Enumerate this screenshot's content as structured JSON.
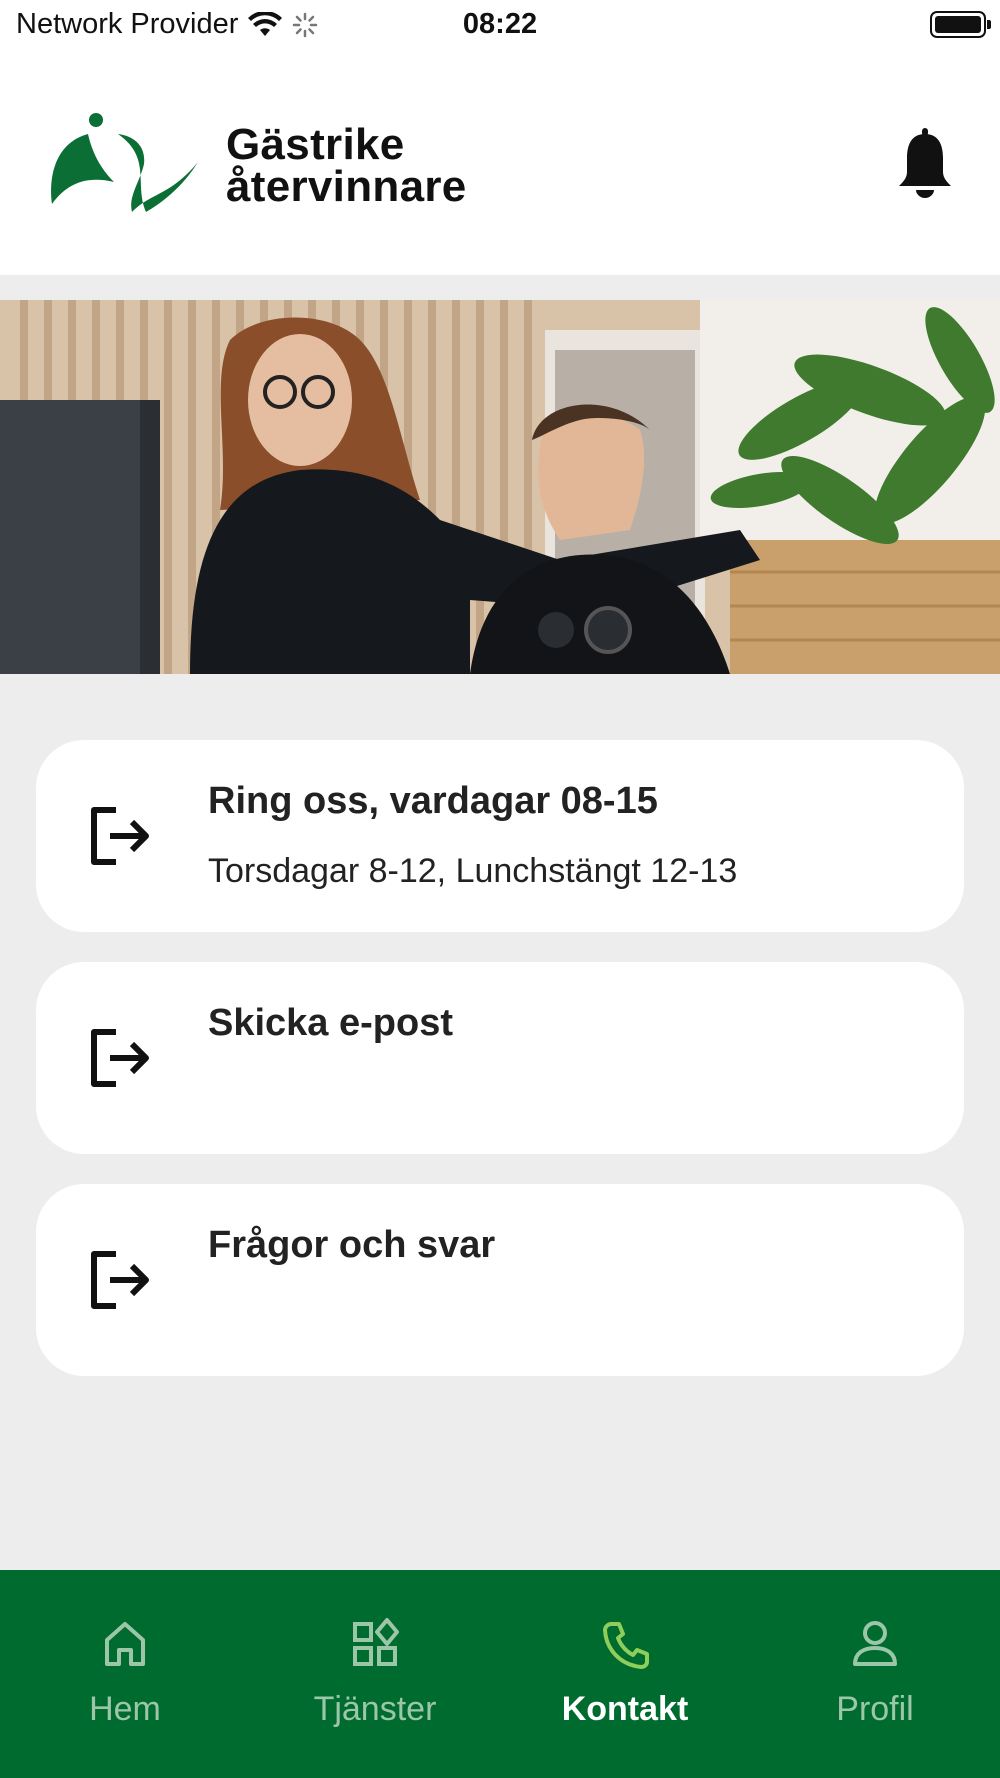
{
  "status_bar": {
    "carrier": "Network Provider",
    "time": "08:22"
  },
  "header": {
    "logo_line1": "Gästrike",
    "logo_line2": "återvinnare",
    "logo_color": "#0a6e35",
    "bell_icon": "bell-icon"
  },
  "hero": {
    "icon": "staff-photo"
  },
  "contact_cards": [
    {
      "title": "Ring oss, vardagar 08-15",
      "subtitle": "Torsdagar 8-12, Lunchstängt 12-13",
      "icon": "external-link-icon"
    },
    {
      "title": "Skicka e-post",
      "subtitle": "",
      "icon": "external-link-icon"
    },
    {
      "title": "Frågor och svar",
      "subtitle": "",
      "icon": "external-link-icon"
    }
  ],
  "bottom_nav": {
    "background": "#006b2f",
    "active_color": "#8fce5a",
    "items": [
      {
        "label": "Hem",
        "icon": "home-icon",
        "active": false
      },
      {
        "label": "Tjänster",
        "icon": "services-grid-icon",
        "active": false
      },
      {
        "label": "Kontakt",
        "icon": "phone-icon",
        "active": true
      },
      {
        "label": "Profil",
        "icon": "person-icon",
        "active": false
      }
    ]
  }
}
